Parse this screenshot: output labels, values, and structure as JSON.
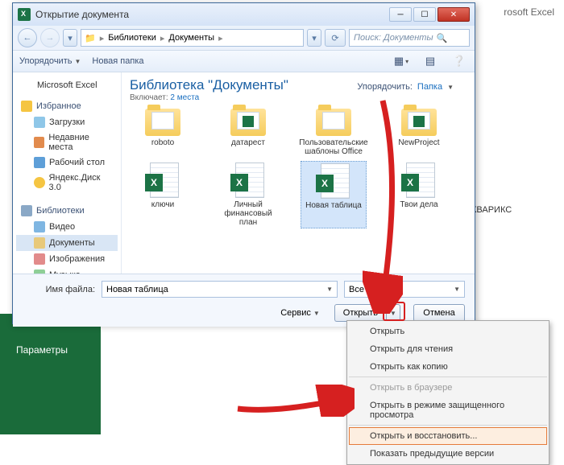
{
  "excel_bg": {
    "app_suffix": "rosoft Excel",
    "sidebar_item": "Параметры",
    "side_text": "КВАРИКС"
  },
  "dialog": {
    "title": "Открытие документа",
    "breadcrumb": {
      "root_icon": "folder",
      "part1": "Библиотеки",
      "part2": "Документы"
    },
    "search_placeholder": "Поиск: Документы",
    "toolbar": {
      "organize": "Упорядочить",
      "new_folder": "Новая папка"
    },
    "sidebar": {
      "fav_header": "Избранное",
      "fav_items": [
        "Загрузки",
        "Недавние места",
        "Рабочий стол",
        "Яндекс.Диск 3.0"
      ],
      "lib_header": "Библиотеки",
      "lib_items": [
        "Видео",
        "Документы",
        "Изображения",
        "Музыка"
      ]
    },
    "location": {
      "title": "Библиотека \"Документы\"",
      "sub_prefix": "Включает:",
      "sub_link": "2 места"
    },
    "sort": {
      "label": "Упорядочить:",
      "value": "Папка"
    },
    "items": {
      "folders": [
        "roboto",
        "датарест",
        "Пользовательские шаблоны Office",
        "NewProject"
      ],
      "files": [
        "ключи",
        "Личный финансовый план",
        "Новая таблица",
        "Твои дела"
      ],
      "selected_file_index": 2
    },
    "footer": {
      "name_label": "Имя файла:",
      "name_value": "Новая таблица",
      "filter_value": "Все файлы",
      "tools": "Сервис",
      "open": "Открыть",
      "cancel": "Отмена"
    }
  },
  "dropdown_menu": {
    "items": [
      {
        "label": "Открыть",
        "disabled": false
      },
      {
        "label": "Открыть для чтения",
        "disabled": false
      },
      {
        "label": "Открыть как копию",
        "disabled": false,
        "sep_after": true
      },
      {
        "label": "Открыть в браузере",
        "disabled": true
      },
      {
        "label": "Открыть в режиме защищенного просмотра",
        "disabled": false,
        "sep_after": true
      },
      {
        "label": "Открыть и восстановить...",
        "disabled": false,
        "highlight": true
      },
      {
        "label": "Показать предыдущие версии",
        "disabled": false
      }
    ]
  },
  "brand": "Microsoft Excel"
}
